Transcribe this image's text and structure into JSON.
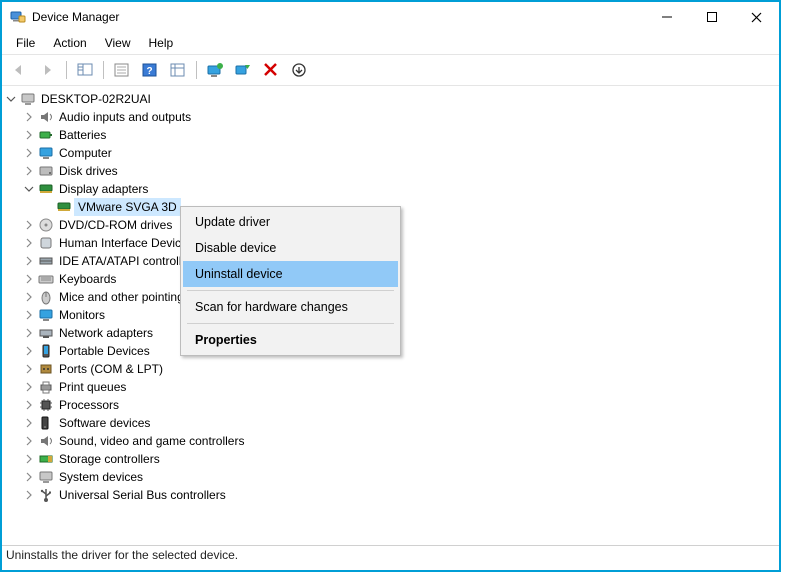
{
  "window": {
    "title": "Device Manager"
  },
  "menu": {
    "file": "File",
    "action": "Action",
    "view": "View",
    "help": "Help"
  },
  "toolbar_icons": {
    "back": "back-icon",
    "forward": "forward-icon",
    "show_hide": "show-hide-icon",
    "properties": "properties-icon",
    "help": "help-icon",
    "details": "details-icon",
    "monitor": "monitor-icon",
    "scan": "scan-icon",
    "delete": "delete-icon",
    "update": "update-icon"
  },
  "tree": {
    "root": "DESKTOP-02R2UAI",
    "items": [
      "Audio inputs and outputs",
      "Batteries",
      "Computer",
      "Disk drives",
      "Display adapters",
      "DVD/CD-ROM drives",
      "Human Interface Devices",
      "IDE ATA/ATAPI controllers",
      "Keyboards",
      "Mice and other pointing devices",
      "Monitors",
      "Network adapters",
      "Portable Devices",
      "Ports (COM & LPT)",
      "Print queues",
      "Processors",
      "Software devices",
      "Sound, video and game controllers",
      "Storage controllers",
      "System devices",
      "Universal Serial Bus controllers"
    ],
    "display_child": "VMware SVGA 3D"
  },
  "context_menu": {
    "update": "Update driver",
    "disable": "Disable device",
    "uninstall": "Uninstall device",
    "scan": "Scan for hardware changes",
    "properties": "Properties"
  },
  "statusbar": "Uninstalls the driver for the selected device."
}
